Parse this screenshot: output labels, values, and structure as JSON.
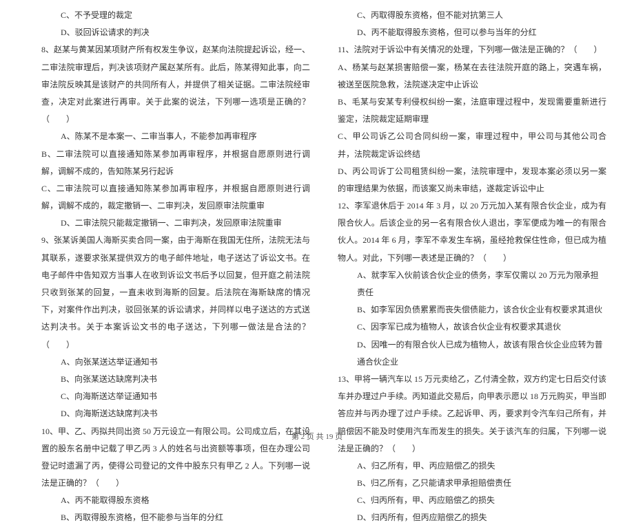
{
  "left": {
    "opt_c": "C、不予受理的裁定",
    "opt_d": "D、驳回诉讼请求的判决",
    "q8": "8、赵某与黄某因某项财产所有权发生争议，赵某向法院提起诉讼，经一、二审法院审理后，判决该项财产属赵某所有。此后，陈某得知此事，向二审法院反映其是该财产的共同所有人，并提供了相关证据。二审法院经审查，决定对此案进行再审。关于此案的说法，下列哪一选项是正确的？（　　）",
    "q8_a": "A、陈某不是本案一、二审当事人，不能参加再审程序",
    "q8_b": "B、二审法院可以直接通知陈某参加再审程序，并根据自愿原则进行调解，调解不成的，告知陈某另行起诉",
    "q8_c": "C、二审法院可以直接通知陈某参加再审程序，并根据自愿原则进行调解，调解不成的，裁定撤销一、二审判决，发回原审法院重审",
    "q8_d": "D、二审法院只能裁定撤销一、二审判决，发回原审法院重审",
    "q9": "9、张某诉美国人海斯买卖合同一案，由于海斯在我国无住所，法院无法与其联系，遂要求张某提供双方的电子邮件地址，电子送达了诉讼文书。在电子邮件中告知双方当事人在收到诉讼文书后予以回复，但开庭之前法院只收到张某的回复，一直未收到海斯的回复。后法院在海斯缺席的情况下，对案件作出判决，驳回张某的诉讼请求，并同样以电子送达的方式送达判决书。关于本案诉讼文书的电子送达，下列哪一做法是合法的？（　　）",
    "q9_a": "A、向张某送达举证通知书",
    "q9_b": "B、向张某送达缺席判决书",
    "q9_c": "C、向海斯送达举证通知书",
    "q9_d": "D、向海斯送达缺席判决书",
    "q10": "10、甲、乙、丙拟共同出资 50 万元设立一有限公司。公司成立后，在其设置的股东名册中记载了甲乙丙 3 人的姓名与出资额等事项，但在办理公司登记时遗漏了丙，使得公司登记的文件中股东只有甲乙 2 人。下列哪一说法是正确的？（　　）",
    "q10_a": "A、丙不能取得股东资格",
    "q10_b": "B、丙取得股东资格，但不能参与当年的分红"
  },
  "right": {
    "q10_c": "C、丙取得股东资格，但不能对抗第三人",
    "q10_d": "D、丙不能取得股东资格，但可以参与当年的分红",
    "q11": "11、法院对于诉讼中有关情况的处理，下列哪一做法是正确的？（　　）",
    "q11_a": "A、杨某与赵某损害赔偿一案，杨某在去往法院开庭的路上，突遇车祸，被送至医院急救，法院遂决定中止诉讼",
    "q11_b": "B、毛某与安某专利侵权纠纷一案，法庭审理过程中，发现需要重新进行鉴定，法院裁定延期审理",
    "q11_c": "C、甲公司诉乙公司合同纠纷一案，审理过程中，甲公司与其他公司合并，法院裁定诉讼终结",
    "q11_d": "D、丙公司诉丁公司租赁纠纷一案，法院审理中，发现本案必须以另一案的审理结果为依据，而该案又尚未审结，遂裁定诉讼中止",
    "q12": "12、李军退休后于 2014 年 3 月，以 20 万元加入某有限合伙企业，成为有限合伙人。后该企业的另一名有限合伙人退出，李军便成为唯一的有限合伙人。2014 年 6 月，李军不幸发生车祸，虽经抢救保住性命，但已成为植物人。对此，下列哪一表述是正确的？（　　）",
    "q12_a": "A、就李军入伙前该合伙企业的债务，李军仅需以 20 万元为限承担责任",
    "q12_b": "B、如李军因负债累累而丧失偿债能力，该合伙企业有权要求其退伙",
    "q12_c": "C、因李军已成为植物人，故该合伙企业有权要求其退伙",
    "q12_d": "D、因唯一的有限合伙人已成为植物人，故该有限合伙企业应转为普通合伙企业",
    "q13": "13、甲将一辆汽车以 15 万元卖给乙，乙付清全款，双方约定七日后交付该车并办理过户手续。丙知道此交易后，向甲表示愿以 18 万元购买，甲当即答应并与丙办理了过户手续。乙起诉甲、丙，要求判令汽车归己所有，并赔偿因不能及时使用汽车而发生的损失。关于该汽车的归属，下列哪一说法是正确的？（　　）",
    "q13_a": "A、归乙所有，甲、丙应赔偿乙的损失",
    "q13_b": "B、归乙所有，乙只能请求甲承担赔偿责任",
    "q13_c": "C、归丙所有，甲、丙应赔偿乙的损失",
    "q13_d": "D、归丙所有，但丙应赔偿乙的损失"
  },
  "footer": "第 2 页 共 19 页"
}
